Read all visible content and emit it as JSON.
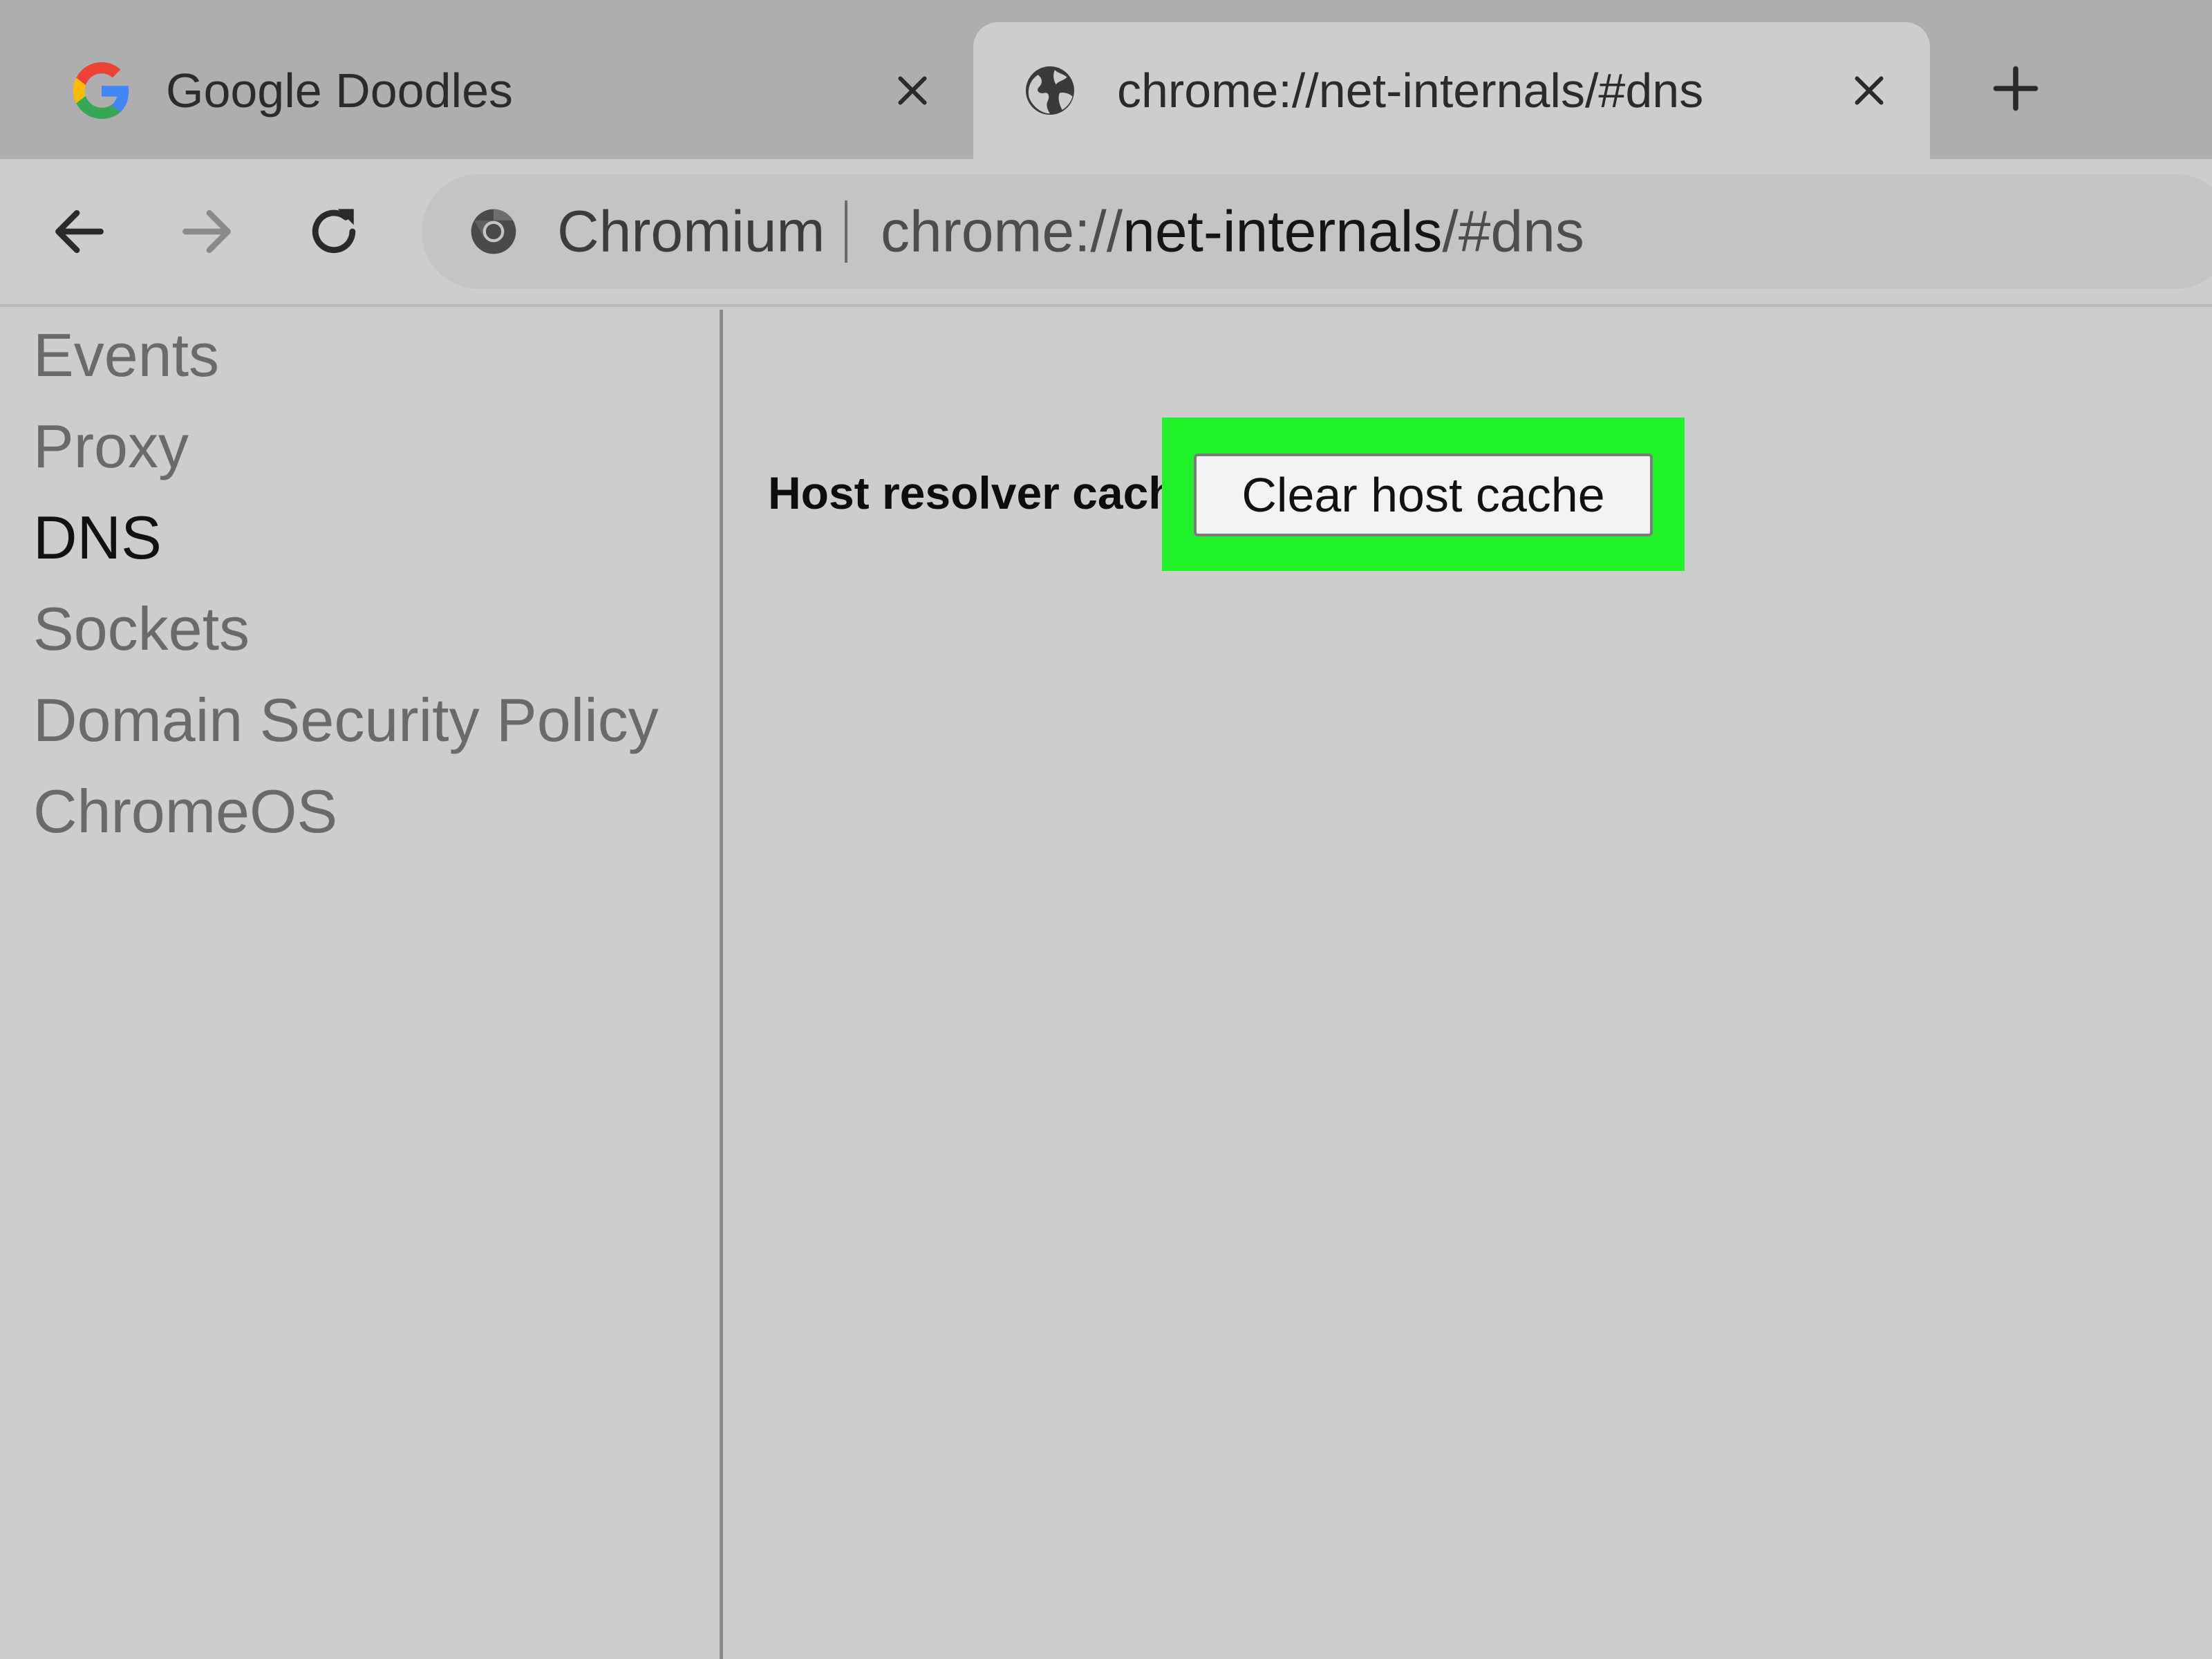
{
  "tabs": [
    {
      "title": "Google Doodles",
      "icon": "google-g-icon",
      "active": false
    },
    {
      "title": "chrome://net-internals/#dns",
      "icon": "globe-icon",
      "active": true
    }
  ],
  "toolbar": {
    "site_name": "Chromium",
    "url_scheme": "chrome://",
    "url_host": "net-internals",
    "url_path": "/#dns"
  },
  "sidebar": {
    "items": [
      {
        "label": "Events"
      },
      {
        "label": "Proxy"
      },
      {
        "label": "DNS",
        "selected": true
      },
      {
        "label": "Sockets"
      },
      {
        "label": "Domain Security Policy"
      },
      {
        "label": "ChromeOS"
      }
    ]
  },
  "main": {
    "section_label": "Host resolver cache",
    "clear_button_label": "Clear host cache"
  },
  "colors": {
    "highlight": "#22f22a",
    "background": "#cdcdcd",
    "tabstrip": "#aeaeb1"
  }
}
